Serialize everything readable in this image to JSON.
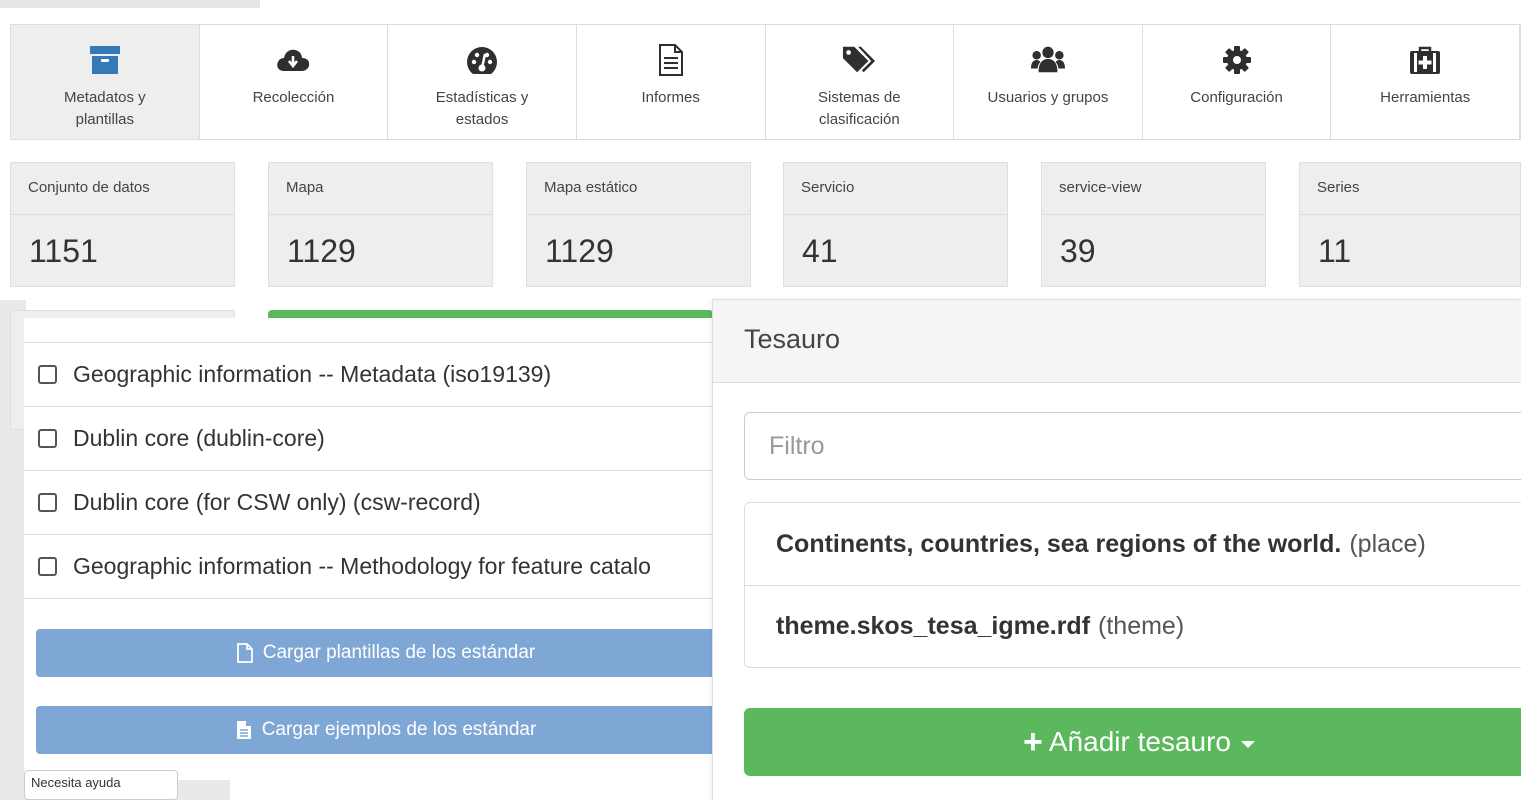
{
  "colors": {
    "nav_icon": "#2f2f2f",
    "nav_active_icon": "#337ab7",
    "success_button": "#5cb85c",
    "primary_button": "#7fa7d6"
  },
  "nav": {
    "items": [
      {
        "label": "Metadatos y plantillas",
        "icon": "archive-icon",
        "active": true
      },
      {
        "label": "Recolección",
        "icon": "cloud-download-icon"
      },
      {
        "label": "Estadísticas y estados",
        "icon": "dashboard-icon"
      },
      {
        "label": "Informes",
        "icon": "file-text-icon"
      },
      {
        "label": "Sistemas de clasificación",
        "icon": "tags-icon"
      },
      {
        "label": "Usuarios y grupos",
        "icon": "users-icon"
      },
      {
        "label": "Configuración",
        "icon": "gear-icon"
      },
      {
        "label": "Herramientas",
        "icon": "medkit-icon"
      }
    ]
  },
  "stats": [
    {
      "label": "Conjunto de datos",
      "value": "1151"
    },
    {
      "label": "Mapa",
      "value": "1129"
    },
    {
      "label": "Mapa estático",
      "value": "1129"
    },
    {
      "label": "Servicio",
      "value": "41"
    },
    {
      "label": "service-view",
      "value": "39"
    },
    {
      "label": "Series",
      "value": "11"
    }
  ],
  "standards": {
    "items": [
      {
        "label": "Geographic information -- Metadata (iso19139)",
        "checked": false
      },
      {
        "label": "Dublin core (dublin-core)",
        "checked": false
      },
      {
        "label": "Dublin core (for CSW only) (csw-record)",
        "checked": false
      },
      {
        "label": "Geographic information -- Methodology for feature catalo",
        "checked": false
      }
    ],
    "load_templates_label": "Cargar plantillas de los estándar",
    "load_examples_label": "Cargar ejemplos de los estándar",
    "help_label": "Necesita ayuda"
  },
  "thesaurus": {
    "title": "Tesauro",
    "filter_placeholder": "Filtro",
    "items": [
      {
        "name": "Continents, countries, sea regions of the world.",
        "type": "(place)"
      },
      {
        "name": "theme.skos_tesa_igme.rdf",
        "type": "(theme)"
      }
    ],
    "add_label": "Añadir tesauro"
  }
}
